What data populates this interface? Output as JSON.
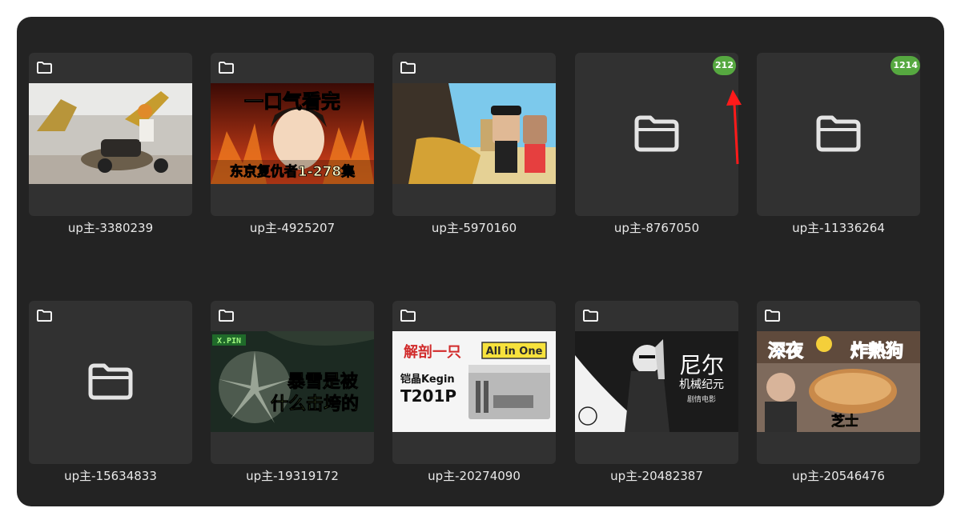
{
  "icons": {
    "folder_small": "folder-icon",
    "folder_large": "folder-icon",
    "annotation": "red-arrow-annotation"
  },
  "colors": {
    "window_bg": "#232323",
    "tile_bg": "#313131",
    "badge_bg": "#56a840",
    "label_text": "#e8e8e8",
    "arrow": "#ff1a1a"
  },
  "folders": [
    {
      "label": "up主-3380239",
      "thumbnail": "photo",
      "badge": ""
    },
    {
      "label": "up主-4925207",
      "thumbnail": "image",
      "badge": "",
      "overlay_text": [
        "一口气看完",
        "东京复仇者1-278集"
      ]
    },
    {
      "label": "up主-5970160",
      "thumbnail": "image",
      "badge": ""
    },
    {
      "label": "up主-8767050",
      "thumbnail": "none",
      "badge": "212"
    },
    {
      "label": "up主-11336264",
      "thumbnail": "none",
      "badge": "1214"
    },
    {
      "label": "up主-15634833",
      "thumbnail": "none",
      "badge": ""
    },
    {
      "label": "up主-19319172",
      "thumbnail": "image",
      "badge": "",
      "overlay_text": [
        "X.PIN",
        "暴雪是被",
        "什么击垮的"
      ]
    },
    {
      "label": "up主-20274090",
      "thumbnail": "image",
      "badge": "",
      "overlay_text": [
        "解剖一只",
        "All in One",
        "铠晶Kegin",
        "T201P"
      ]
    },
    {
      "label": "up主-20482387",
      "thumbnail": "image",
      "badge": "",
      "overlay_text": [
        "尼尔",
        "机械纪元",
        "剧情电影"
      ]
    },
    {
      "label": "up主-20546476",
      "thumbnail": "image",
      "badge": "",
      "overlay_text": [
        "深夜",
        "炸熱狗",
        "芝士"
      ]
    }
  ]
}
